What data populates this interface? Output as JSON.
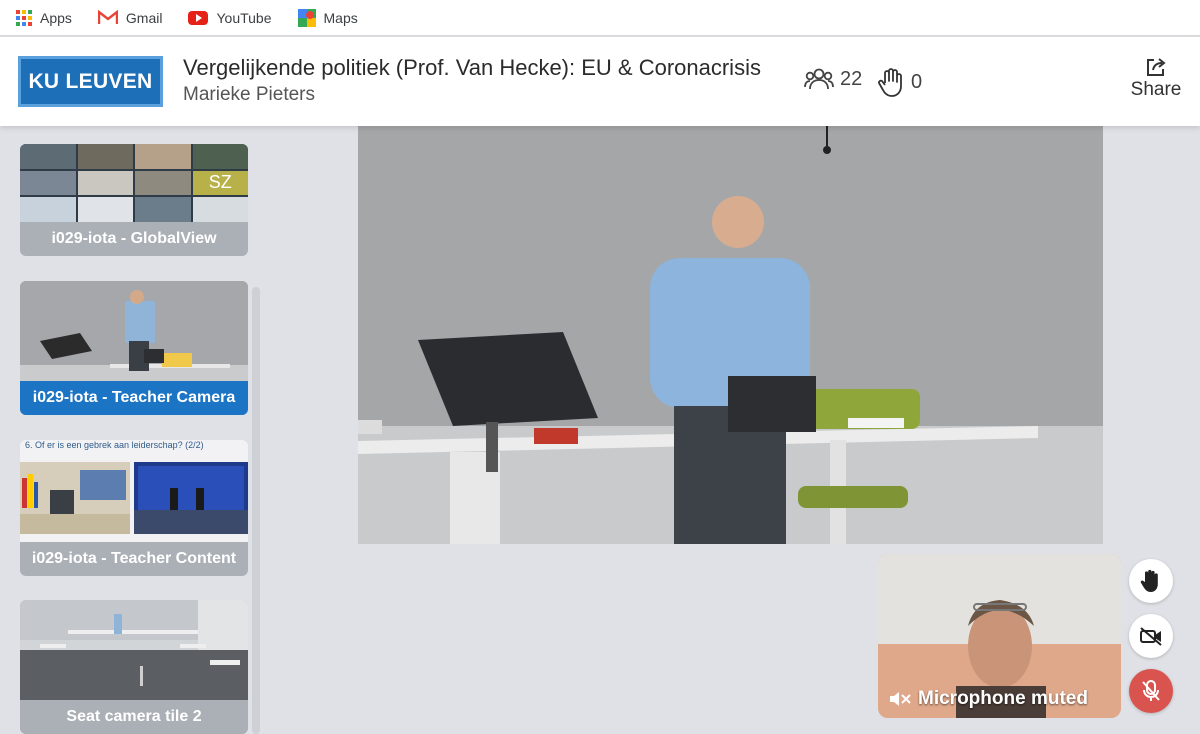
{
  "bookmarks": [
    {
      "label": "Apps",
      "icon": "apps-grid-icon"
    },
    {
      "label": "Gmail",
      "icon": "gmail-icon"
    },
    {
      "label": "YouTube",
      "icon": "youtube-icon"
    },
    {
      "label": "Maps",
      "icon": "maps-icon"
    }
  ],
  "header": {
    "logo_text": "KU LEUVEN",
    "title": "Vergelijkende politiek (Prof. Van Hecke): EU & Coronacrisis",
    "subtitle": "Marieke Pieters",
    "participants_count": "22",
    "raised_hands_count": "0",
    "share_label": "Share"
  },
  "sidebar": {
    "tiles": [
      {
        "label": "i029-iota - GlobalView",
        "active": false,
        "overlay_initials": "SZ"
      },
      {
        "label": "i029-iota - Teacher Camera",
        "active": true
      },
      {
        "label": "i029-iota - Teacher Content",
        "active": false,
        "slide_caption": "6. Of er is een gebrek aan leiderschap? (2/2)"
      },
      {
        "label": "Seat camera tile 2",
        "active": false
      }
    ]
  },
  "self_view": {
    "status": "Microphone muted"
  },
  "controls": [
    {
      "name": "raise-hand-button",
      "icon": "hand-icon"
    },
    {
      "name": "camera-toggle-button",
      "icon": "camera-off-icon"
    },
    {
      "name": "mic-toggle-button",
      "icon": "mic-off-icon"
    }
  ],
  "colors": {
    "accent": "#1c74c4",
    "tile_label_bg": "#aab0b6",
    "mute_button": "#d9534f",
    "background": "#dfe1e6"
  }
}
